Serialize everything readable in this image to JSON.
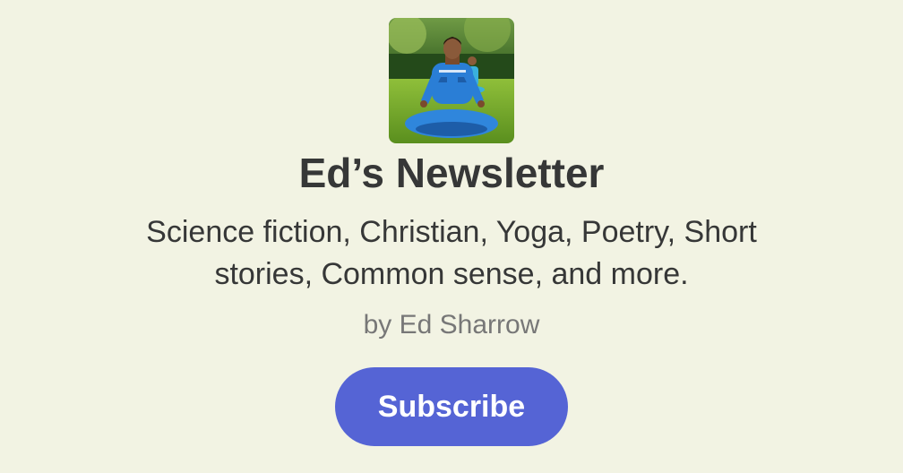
{
  "publication": {
    "logo_icon": "meditating-man-in-blue-uniform-image",
    "title": "Ed’s Newsletter",
    "description": "Science fiction, Christian, Yoga, Poetry, Short stories, Common sense, and more.",
    "author": "by Ed Sharrow"
  },
  "actions": {
    "subscribe_label": "Subscribe"
  },
  "colors": {
    "background": "#f2f3e3",
    "accent": "#5564d5",
    "title_text": "#363737",
    "muted_text": "#777777"
  }
}
